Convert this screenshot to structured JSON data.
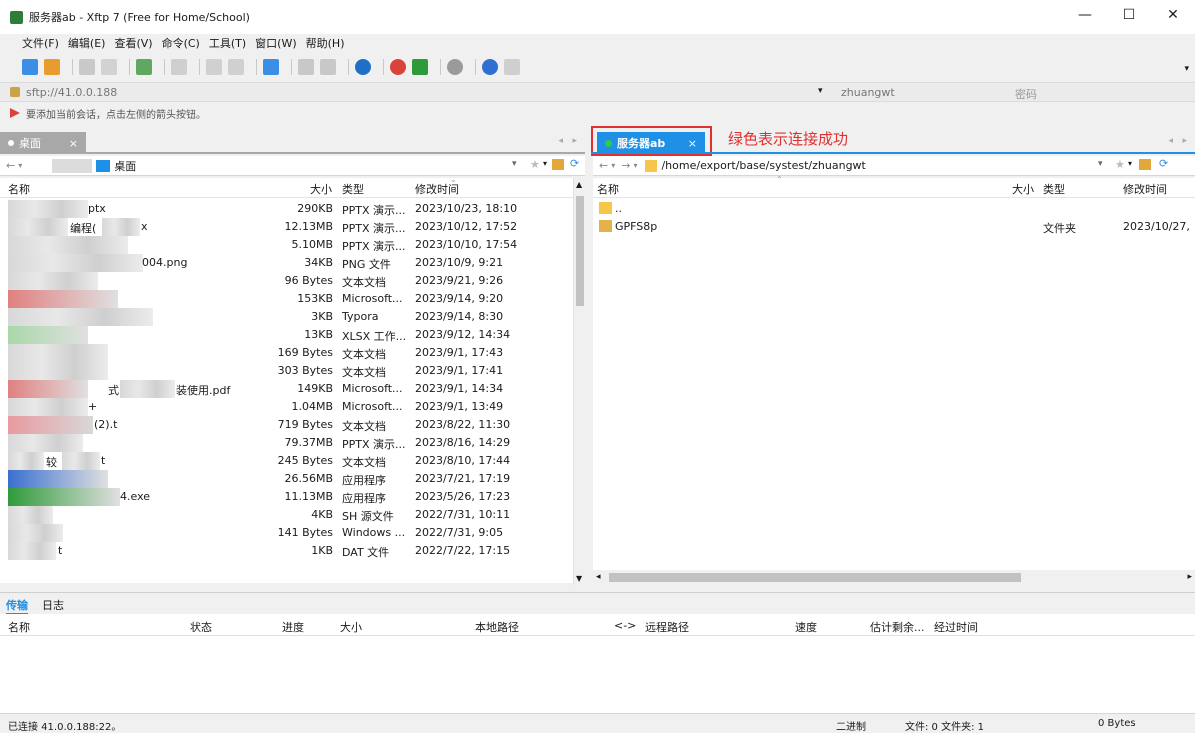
{
  "window": {
    "title": "服务器ab - Xftp 7 (Free for Home/School)",
    "app_icon": "Xftp",
    "controls": [
      "—",
      "☐",
      "✕"
    ]
  },
  "menu": [
    "文件(F)",
    "编辑(E)",
    "查看(V)",
    "命令(C)",
    "工具(T)",
    "窗口(W)",
    "帮助(H)"
  ],
  "address": {
    "url": "sftp://41.0.0.188",
    "user": "zhuangwt",
    "password_placeholder": "密码"
  },
  "hint": "要添加当前会话，点击左侧的箭头按钮。",
  "left_panel": {
    "tab": "桌面",
    "tab_close": "×",
    "path": "桌面",
    "headers": {
      "name": "名称",
      "size": "大小",
      "type": "类型",
      "modified": "修改时间"
    },
    "rows": [
      {
        "name": "ptx",
        "size": "290KB",
        "type": "PPTX 演示...",
        "modified": "2023/10/23, 18:10"
      },
      {
        "name": "编程(",
        "name2": "x",
        "size": "12.13MB",
        "type": "PPTX 演示...",
        "modified": "2023/10/12, 17:52"
      },
      {
        "name": "",
        "size": "5.10MB",
        "type": "PPTX 演示...",
        "modified": "2023/10/10, 17:54"
      },
      {
        "name": "004.png",
        "size": "34KB",
        "type": "PNG 文件",
        "modified": "2023/10/9, 9:21"
      },
      {
        "name": "",
        "size": "96 Bytes",
        "type": "文本文档",
        "modified": "2023/9/21, 9:26"
      },
      {
        "name": "",
        "size": "153KB",
        "type": "Microsoft...",
        "modified": "2023/9/14, 9:20"
      },
      {
        "name": "",
        "size": "3KB",
        "type": "Typora",
        "modified": "2023/9/14, 8:30"
      },
      {
        "name": "",
        "size": "13KB",
        "type": "XLSX 工作...",
        "modified": "2023/9/12, 14:34"
      },
      {
        "name": "",
        "size": "169 Bytes",
        "type": "文本文档",
        "modified": "2023/9/1, 17:43"
      },
      {
        "name": "",
        "size": "303 Bytes",
        "type": "文本文档",
        "modified": "2023/9/1, 17:41"
      },
      {
        "name": "式",
        "name2": "装使用.pdf",
        "size": "149KB",
        "type": "Microsoft...",
        "modified": "2023/9/1, 14:34"
      },
      {
        "name": "+",
        "size": "1.04MB",
        "type": "Microsoft...",
        "modified": "2023/9/1, 13:49"
      },
      {
        "name": "(2).t",
        "size": "719 Bytes",
        "type": "文本文档",
        "modified": "2023/8/22, 11:30"
      },
      {
        "name": "",
        "size": "79.37MB",
        "type": "PPTX 演示...",
        "modified": "2023/8/16, 14:29"
      },
      {
        "name": "较",
        "name2": "t",
        "size": "245 Bytes",
        "type": "文本文档",
        "modified": "2023/8/10, 17:44"
      },
      {
        "name": "",
        "size": "26.56MB",
        "type": "应用程序",
        "modified": "2023/7/21, 17:19"
      },
      {
        "name": "4.exe",
        "size": "11.13MB",
        "type": "应用程序",
        "modified": "2023/5/26, 17:23"
      },
      {
        "name": "",
        "size": "4KB",
        "type": "SH 源文件",
        "modified": "2022/7/31, 10:11"
      },
      {
        "name": "",
        "size": "141 Bytes",
        "type": "Windows ...",
        "modified": "2022/7/31, 9:05"
      },
      {
        "name": "t",
        "size": "1KB",
        "type": "DAT 文件",
        "modified": "2022/7/22, 17:15"
      }
    ]
  },
  "right_panel": {
    "tab": "服务器ab",
    "tab_close": "×",
    "path": "/home/export/base/systest/zhuangwt",
    "headers": {
      "name": "名称",
      "size": "大小",
      "type": "类型",
      "modified": "修改时间"
    },
    "rows": [
      {
        "name": "..",
        "size": "",
        "type": "",
        "modified": ""
      },
      {
        "name": "GPFS8p",
        "size": "",
        "type": "文件夹",
        "modified": "2023/10/27,"
      }
    ]
  },
  "annotation": "绿色表示连接成功",
  "bottom_tabs": [
    "传输",
    "日志"
  ],
  "transfer_headers": [
    "名称",
    "状态",
    "进度",
    "大小",
    "本地路径",
    "<->",
    "远程路径",
    "速度",
    "估计剩余...",
    "经过时间"
  ],
  "status": {
    "connection": "已连接 41.0.0.188:22。",
    "mode": "二进制",
    "counts": "文件: 0 文件夹: 1",
    "bytes": "0 Bytes"
  },
  "colors": {
    "tab_left": "#a8a8a8",
    "tab_right": "#1e90e6",
    "connected_dot": "#2ecc40",
    "annotation": "#e03030"
  }
}
